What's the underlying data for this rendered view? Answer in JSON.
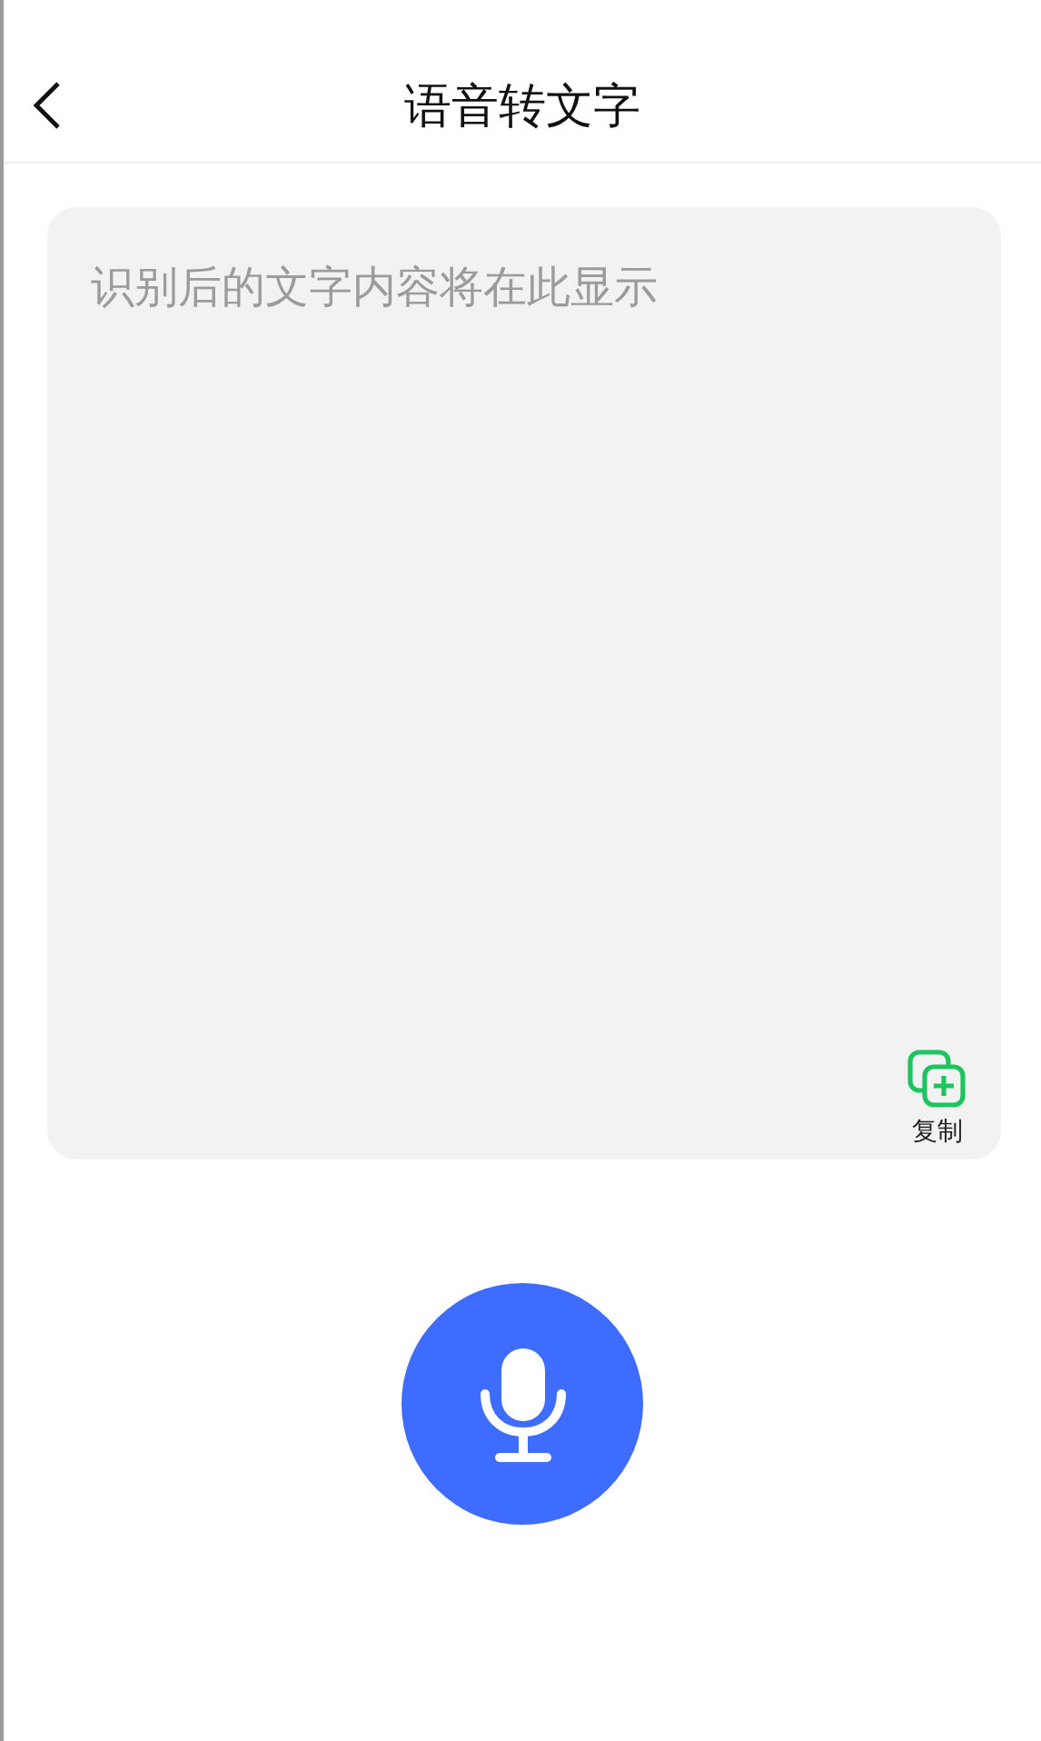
{
  "header": {
    "title": "语音转文字"
  },
  "transcript": {
    "placeholder": "识别后的文字内容将在此显示"
  },
  "copy_button": {
    "label": "复制"
  }
}
